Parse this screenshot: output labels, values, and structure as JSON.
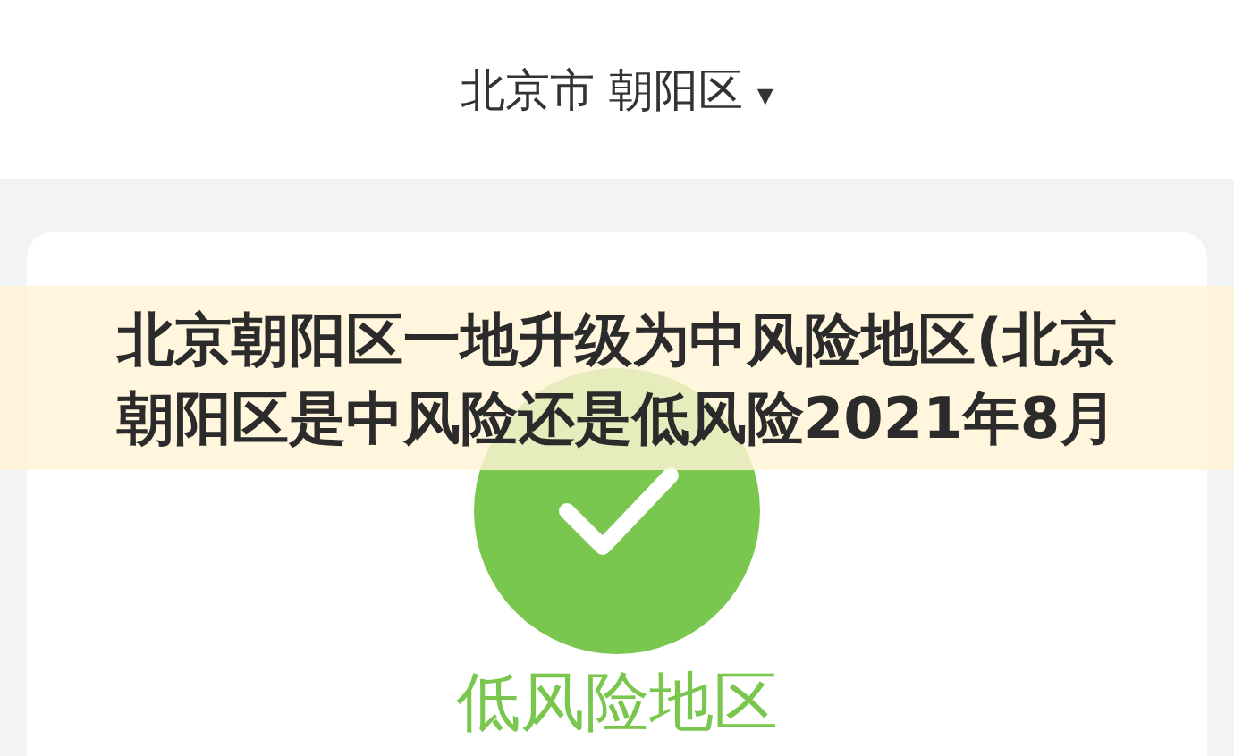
{
  "header": {
    "location": "北京市 朝阳区",
    "dropdown": "▾"
  },
  "result": {
    "color": "#7ac74f",
    "label": "低风险地区"
  },
  "banner": {
    "lines": [
      "北京朝阳区一地升级为中风险地区(北京",
      "朝阳区是中风险还是低风险2021年8月"
    ]
  }
}
